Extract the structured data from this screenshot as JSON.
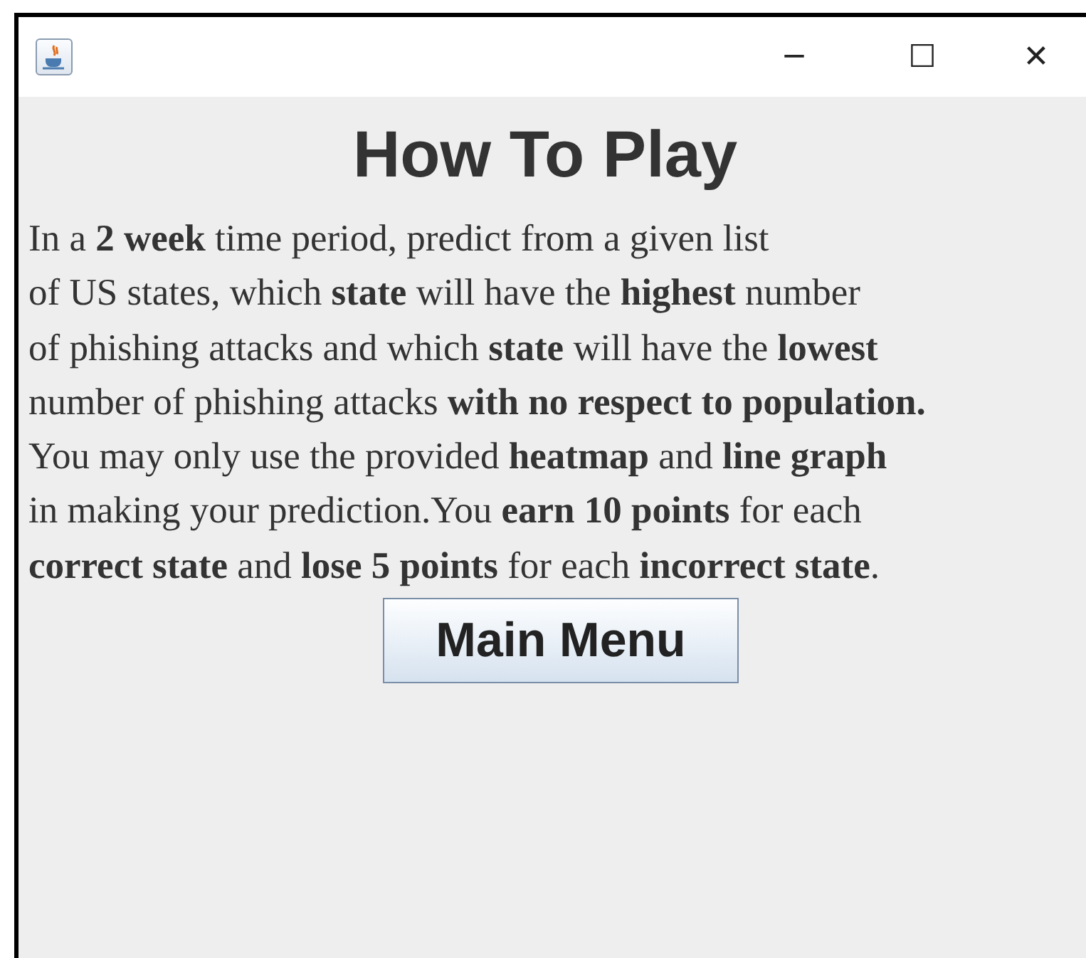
{
  "window": {
    "title_bar": {
      "minimize": "─",
      "maximize": "☐",
      "close": "✕"
    }
  },
  "heading": "How To Play",
  "instructions": [
    "In a **2 week** time period, predict from a given list",
    "of US states, which **state** will have the **highest** number",
    "of phishing attacks and which **state** will have the **lowest**",
    "number of phishing attacks **with no respect to population.**",
    "You may only use the provided **heatmap** and **line graph**",
    "in making your prediction.You **earn 10 points** for each",
    "**correct state** and **lose 5 points** for each **incorrect state**."
  ],
  "buttons": [
    "Main Menu"
  ]
}
